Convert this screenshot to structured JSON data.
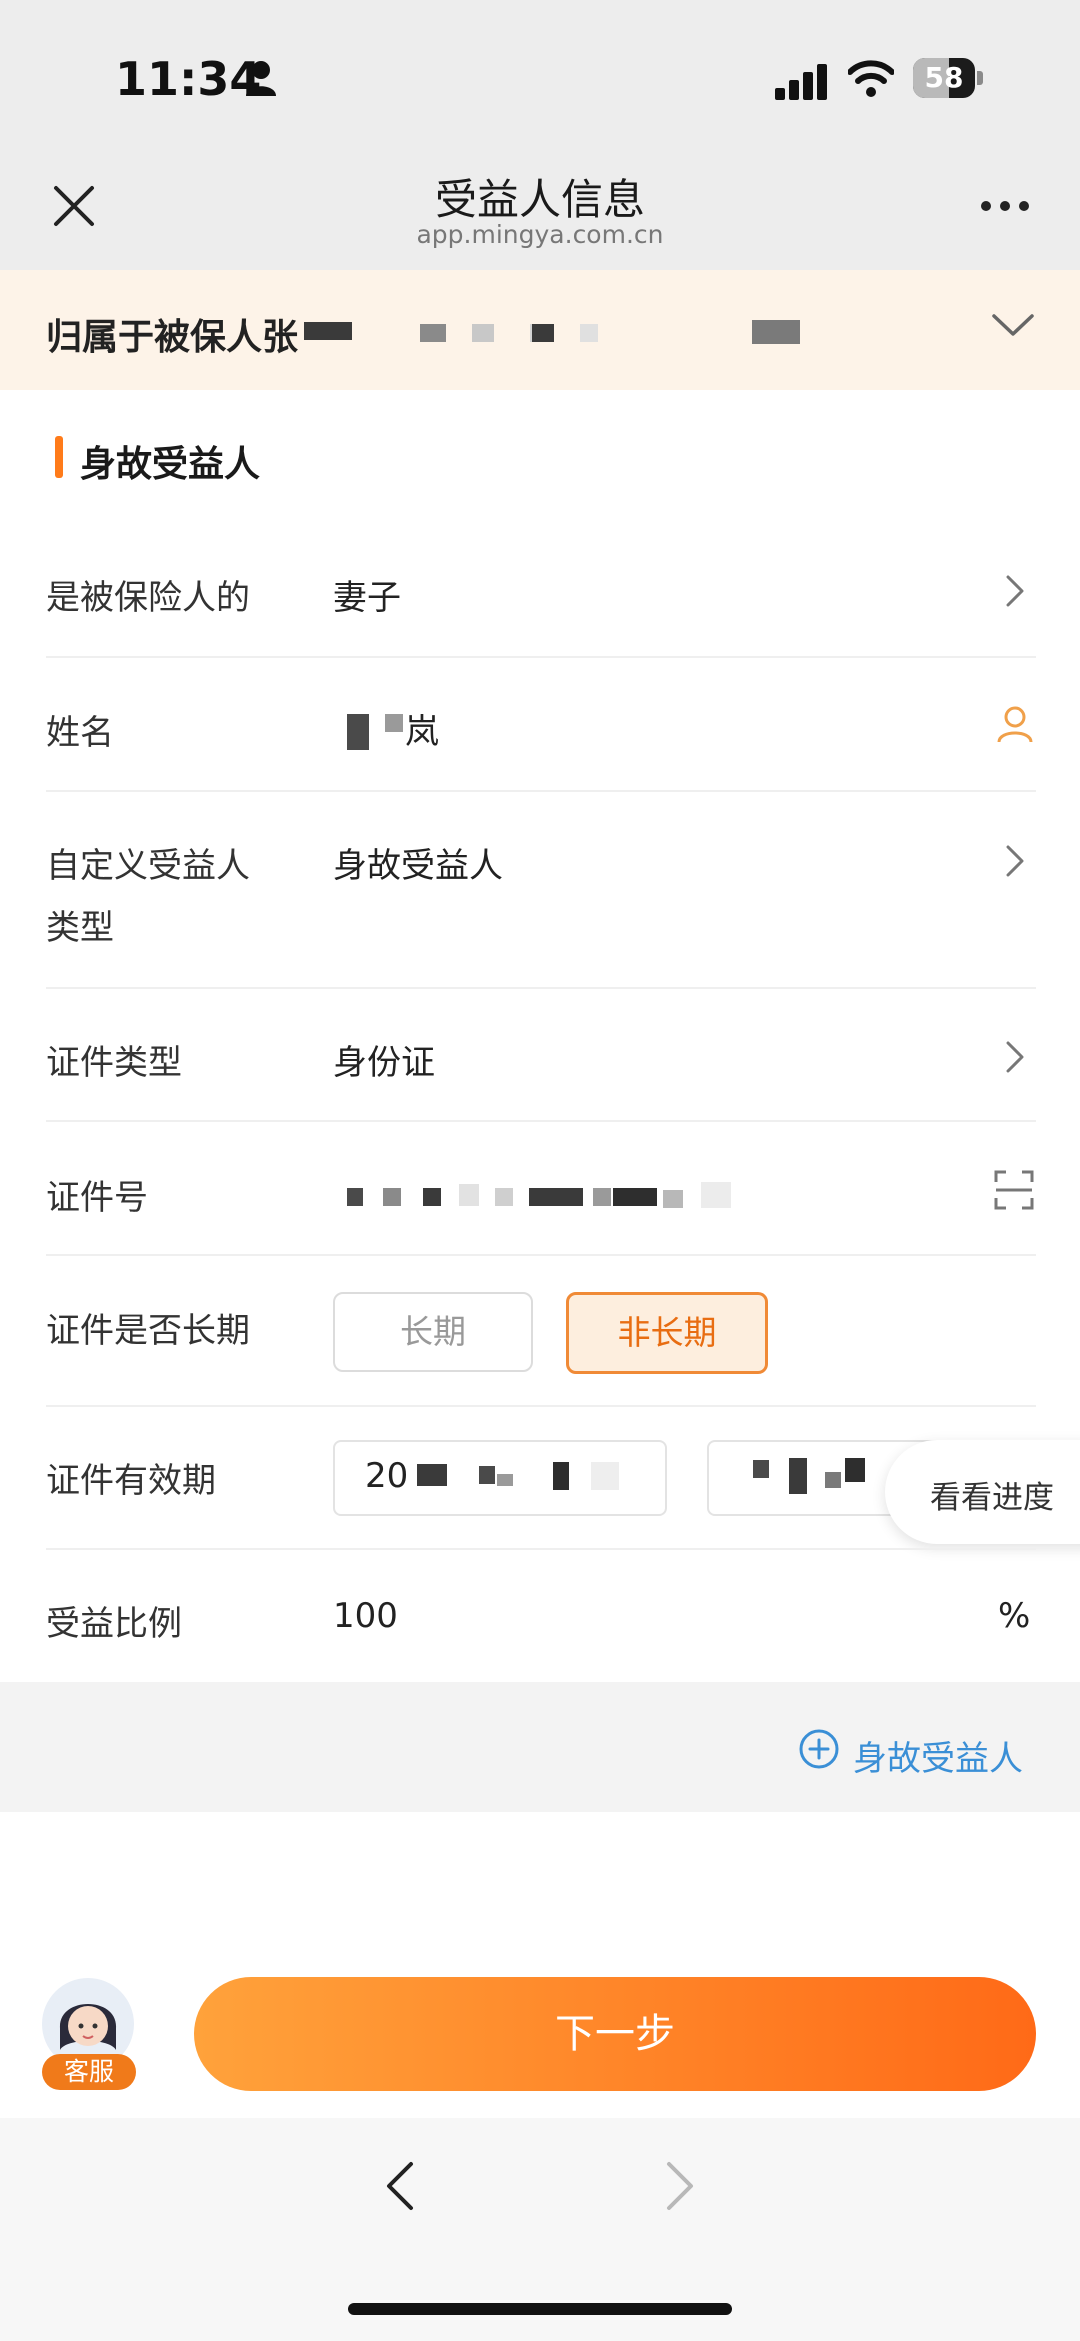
{
  "status_bar": {
    "time": "11:34",
    "battery": "58",
    "battery_level": 0.58
  },
  "nav": {
    "title": "受益人信息",
    "subtitle": "app.mingya.com.cn"
  },
  "owner_banner": {
    "text": "归属于被保人张"
  },
  "section": {
    "title": "身故受益人"
  },
  "form": {
    "relation": {
      "label": "是被保险人的",
      "value": "妻子"
    },
    "name": {
      "label": "姓名",
      "value": "岚"
    },
    "custom_type": {
      "label_line1": "自定义受益人",
      "label_line2": "类型",
      "value": "身故受益人"
    },
    "id_type": {
      "label": "证件类型",
      "value": "身份证"
    },
    "id_number": {
      "label": "证件号"
    },
    "long_term": {
      "label": "证件是否长期",
      "option_long": "长期",
      "option_not_long": "非长期",
      "selected": "非长期"
    },
    "validity": {
      "label": "证件有效期",
      "start_prefix": "20"
    },
    "ratio": {
      "label": "受益比例",
      "value": "100",
      "unit": "%"
    }
  },
  "progress_bubble": {
    "text": "看看进度"
  },
  "add_beneficiary": {
    "label": "身故受益人"
  },
  "footer": {
    "agent_label": "客服",
    "next_label": "下一步"
  },
  "colors": {
    "accent": "#ff7b1a",
    "link": "#3a8fd6",
    "banner_bg": "#fdf3e8"
  }
}
